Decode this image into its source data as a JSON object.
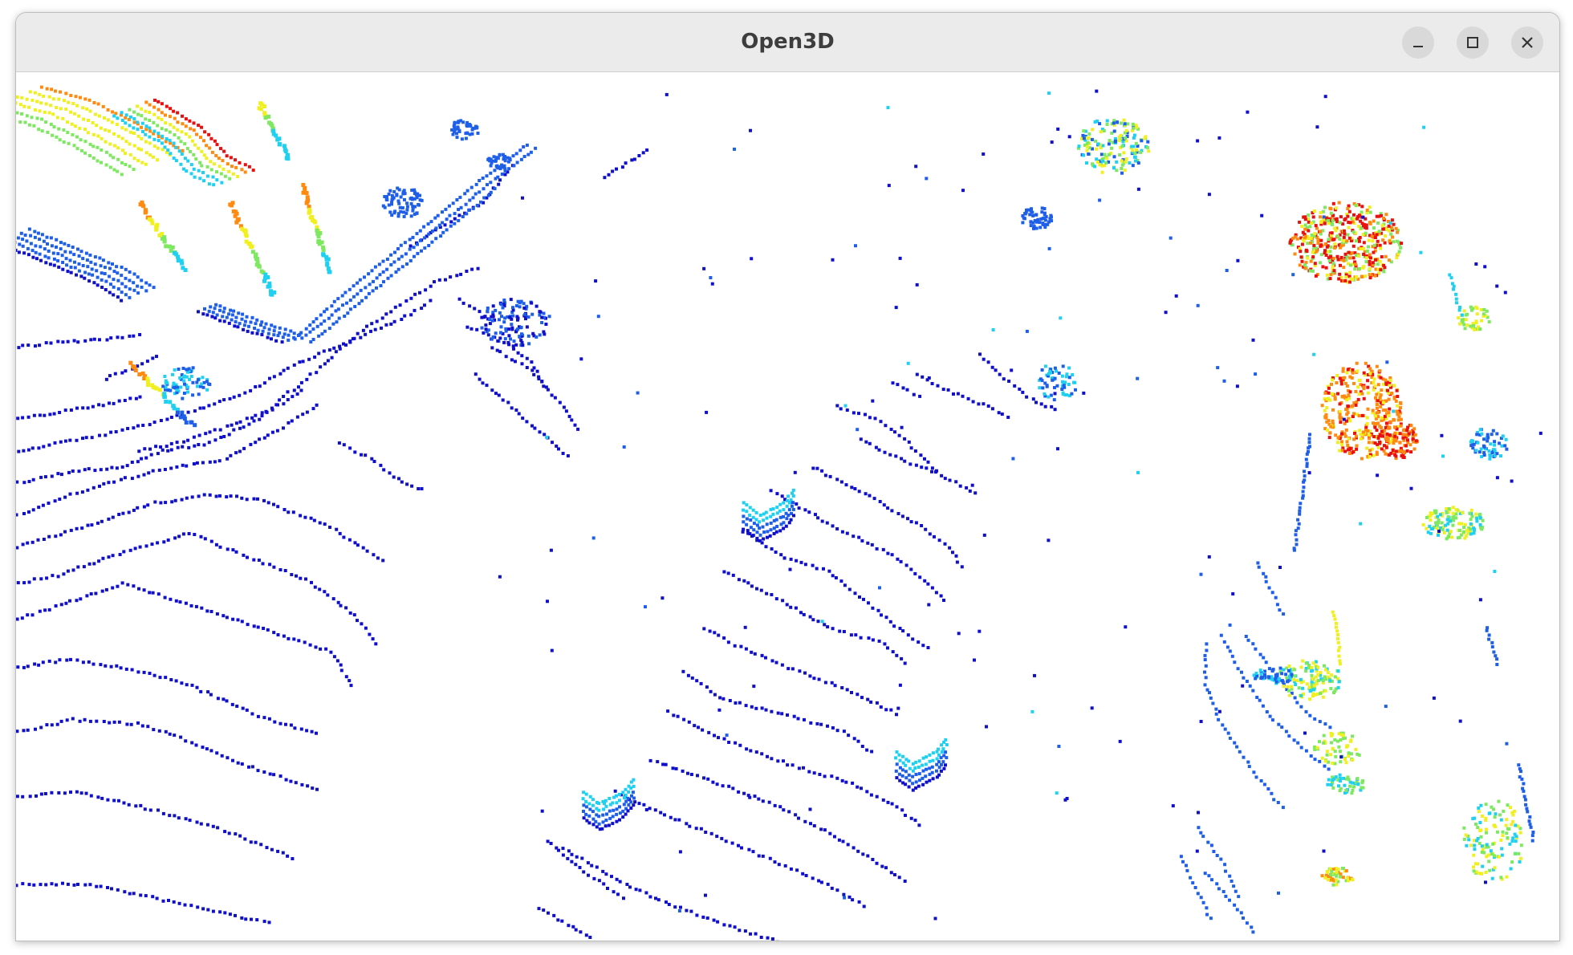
{
  "window": {
    "title": "Open3D",
    "controls": {
      "minimize_icon": "minimize-icon",
      "maximize_icon": "maximize-icon",
      "close_icon": "close-icon"
    }
  },
  "viewport": {
    "background": "#ffffff",
    "colormap": "jet",
    "palette": {
      "low": "#1010c8",
      "blue": "#1f5fe8",
      "cyan": "#20d0f0",
      "green": "#7ee860",
      "yellow": "#f0f020",
      "orange": "#ff8a10",
      "red": "#e81010"
    }
  }
}
